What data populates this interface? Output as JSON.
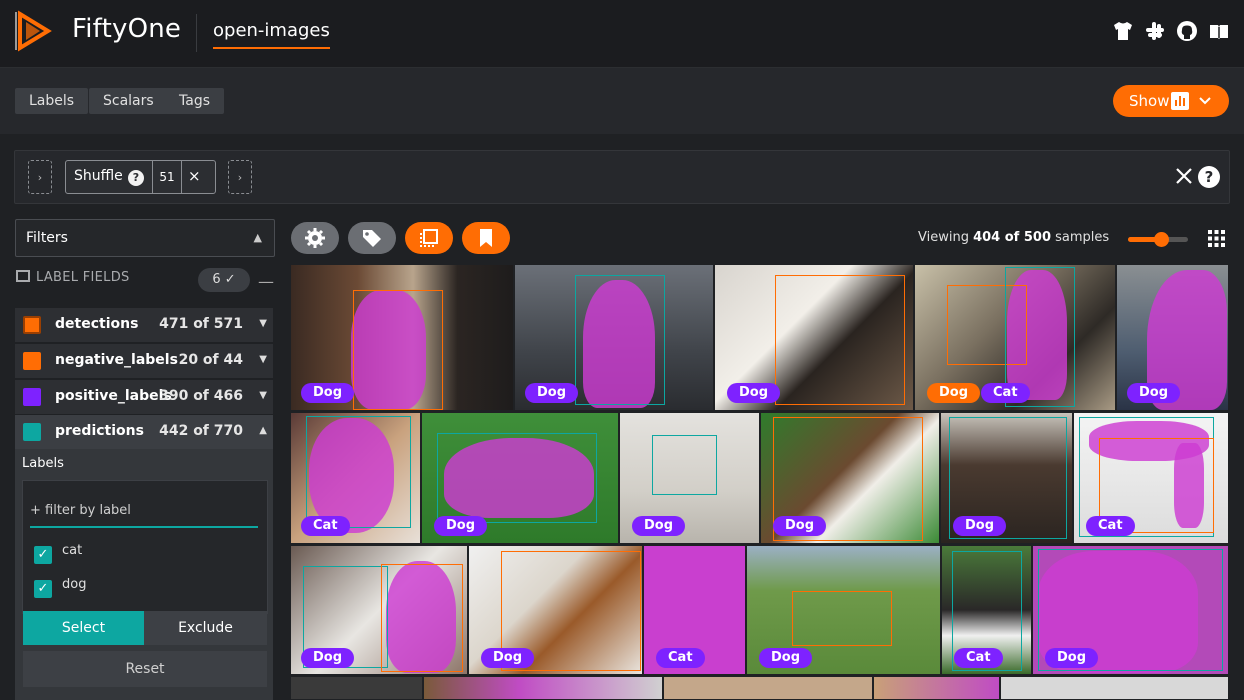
{
  "header": {
    "brand": "FiftyOne",
    "dataset": "open-images",
    "icons": [
      "tshirt-icon",
      "slack-icon",
      "github-icon",
      "book-icon"
    ]
  },
  "topbar": {
    "tabs": [
      "Labels",
      "Scalars",
      "Tags"
    ],
    "show_label": "Show"
  },
  "view_bar": {
    "stage_name": "Shuffle",
    "stage_value": "51",
    "help": "?",
    "remove": "×",
    "arrow": "›"
  },
  "sidebar": {
    "filters_label": "Filters",
    "section_label": "LABEL FIELDS",
    "field_count": "6 ✓",
    "fields": [
      {
        "name": "detections",
        "count": "471 of 571",
        "color": "#ff6d04"
      },
      {
        "name": "negative_labels",
        "count": "20 of 44",
        "color": "#ff6d04"
      },
      {
        "name": "positive_labels",
        "count": "390 of 466",
        "color": "#7e22ff"
      },
      {
        "name": "predictions",
        "count": "442 of 770",
        "color": "#0da7a1"
      }
    ],
    "labels_title": "Labels",
    "filter_placeholder": "+ filter by label",
    "label_values": [
      "cat",
      "dog"
    ],
    "select_label": "Select",
    "exclude_label": "Exclude",
    "reset_label": "Reset"
  },
  "grid": {
    "viewing_prefix": "Viewing",
    "viewing_count": "404 of 500",
    "viewing_suffix": "samples",
    "slider_fraction": 0.55,
    "badges": {
      "t1": "Dog",
      "t2": "Dog",
      "t3": "Dog",
      "t4a": "Dog",
      "t4b": "Cat",
      "t5": "Dog",
      "t6": "Cat",
      "t7": "Dog",
      "t8": "Dog",
      "t9": "Dog",
      "t10": "Dog",
      "t11": "Cat",
      "t12": "Dog",
      "t13": "Dog",
      "t14": "Cat",
      "t15": "Dog",
      "t16": "Cat",
      "t17": "Dog"
    },
    "colors": {
      "accent": "#ff6d04",
      "positive": "#7e22ff",
      "predictions": "#0da7a1"
    }
  }
}
